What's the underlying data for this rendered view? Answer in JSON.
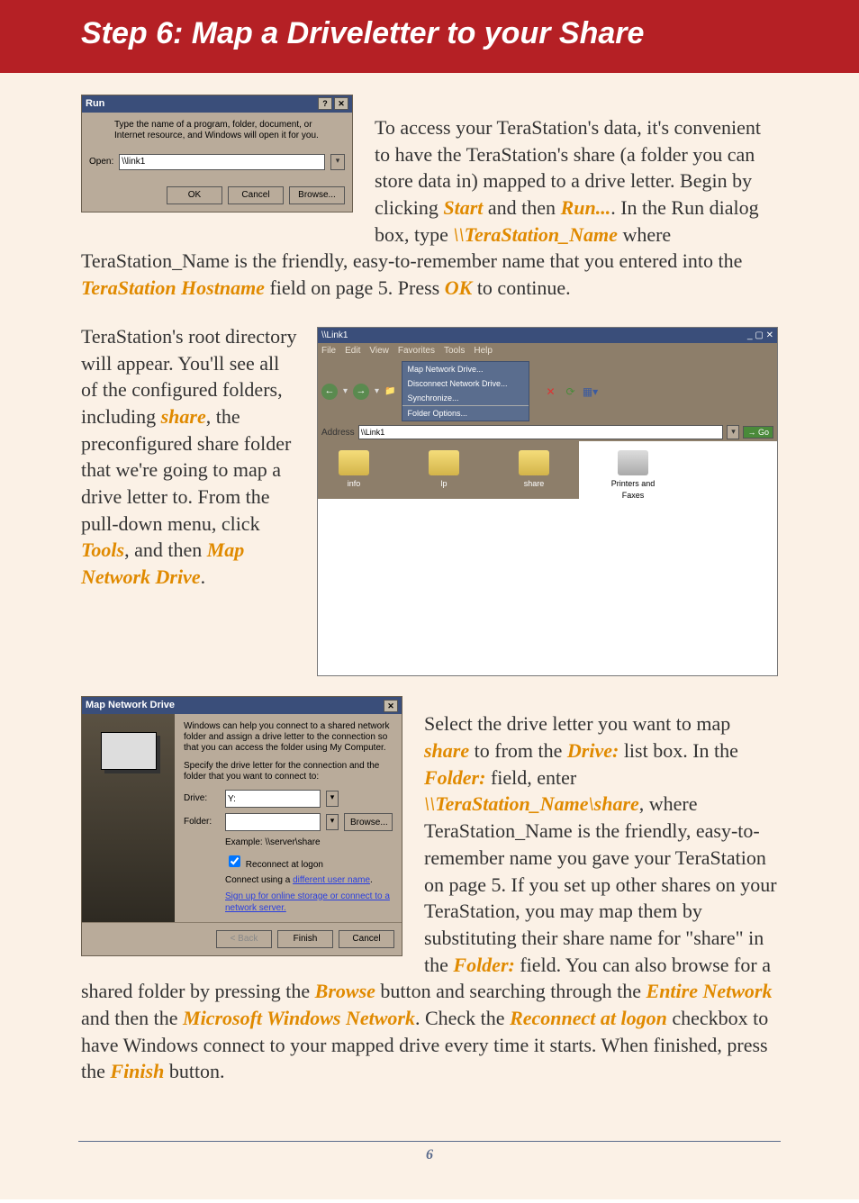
{
  "header": {
    "title": "Step 6:  Map a Driveletter to your Share"
  },
  "run_dialog": {
    "title": "Run",
    "help_icon": "?",
    "close_icon": "✕",
    "body_text": "Type the name of a program, folder, document, or Internet resource, and Windows will open it for you.",
    "open_label": "Open:",
    "open_value": "\\\\link1",
    "btn_ok": "OK",
    "btn_cancel": "Cancel",
    "btn_browse": "Browse..."
  },
  "para1": {
    "t1": "To access your TeraStation's data, it's convenient to have the TeraStation's share (a folder you can store data in) mapped to a drive letter.  Begin by clicking ",
    "start": "Start",
    "t2": " and then ",
    "run": "Run...",
    "t3": ".   In the Run dialog box, type ",
    "cmd": "\\\\TeraStation_Name",
    "t4": " where TeraStation_Name is the friendly, easy-to-remember name that you entered into the ",
    "hostname": "TeraStation Hostname",
    "t5": " field on page 5.  Press ",
    "ok": "OK",
    "t6": " to continue."
  },
  "explorer": {
    "title": "\\\\Link1",
    "win_buttons": "_ ▢ ✕",
    "menu": [
      "File",
      "Edit",
      "View",
      "Favorites",
      "Tools",
      "Help"
    ],
    "tools_menu": [
      "Map Network Drive...",
      "Disconnect Network Drive...",
      "Synchronize...",
      "Folder Options..."
    ],
    "addr_label": "Address",
    "addr_value": "\\\\Link1",
    "go": "Go",
    "folders_top": [
      "info",
      "lp",
      "share"
    ],
    "folder_right": "Printers and Faxes"
  },
  "para2": {
    "t1": "TeraStation's root directory will appear.  You'll see all of the configured folders, including ",
    "share": "share",
    "t2": ", the preconfigured share folder that we're going to map a drive letter to.  From the pull-down menu, click ",
    "tools": "Tools",
    "t3": ", and then ",
    "mapnd": "Map Network Drive",
    "t4": "."
  },
  "map_dialog": {
    "title": "Map Network Drive",
    "close_icon": "✕",
    "p1": "Windows can help you connect to a shared network folder and assign a drive letter to the connection so that you can access the folder using My Computer.",
    "p2": "Specify the drive letter for the connection and the folder that you want to connect to:",
    "drive_label": "Drive:",
    "drive_value": "Y:",
    "folder_label": "Folder:",
    "folder_value": "",
    "browse": "Browse...",
    "example": "Example: \\\\server\\share",
    "reconnect": "Reconnect at logon",
    "diff_user_pre": "Connect using a ",
    "diff_user_link": "different user name",
    "online_link": "Sign up for online storage or connect to a network server.",
    "btn_back": "< Back",
    "btn_finish": "Finish",
    "btn_cancel": "Cancel"
  },
  "para3": {
    "t1": "Select the drive letter you want to map ",
    "share": "share",
    "t2": " to from the ",
    "drive": "Drive:",
    "t3": " list box.  In the ",
    "folder": "Folder:",
    "t4": " field, enter ",
    "path": "\\\\TeraStation_Name\\share",
    "t5": ", where TeraStation_Name is the friendly, easy-to-remember name you gave your TeraStation on page 5.  If you set up other shares on your TeraStation, you may map them by  substituting their share name for \"share\" in the ",
    "folder2": "Folder:",
    "t6": " field.  You can also browse for a shared folder by pressing the  ",
    "browse": "Browse",
    "t7": " button and searching through the ",
    "entire": "Entire Network",
    "t8": " and then the ",
    "mswn": "Microsoft Windows Network",
    "t9": ".  Check the ",
    "recon": "Reconnect at logon",
    "t10": " checkbox to have Windows connect to your mapped drive every time it starts.  When finished, press the ",
    "finish": "Finish",
    "t11": " button."
  },
  "page_number": "6"
}
